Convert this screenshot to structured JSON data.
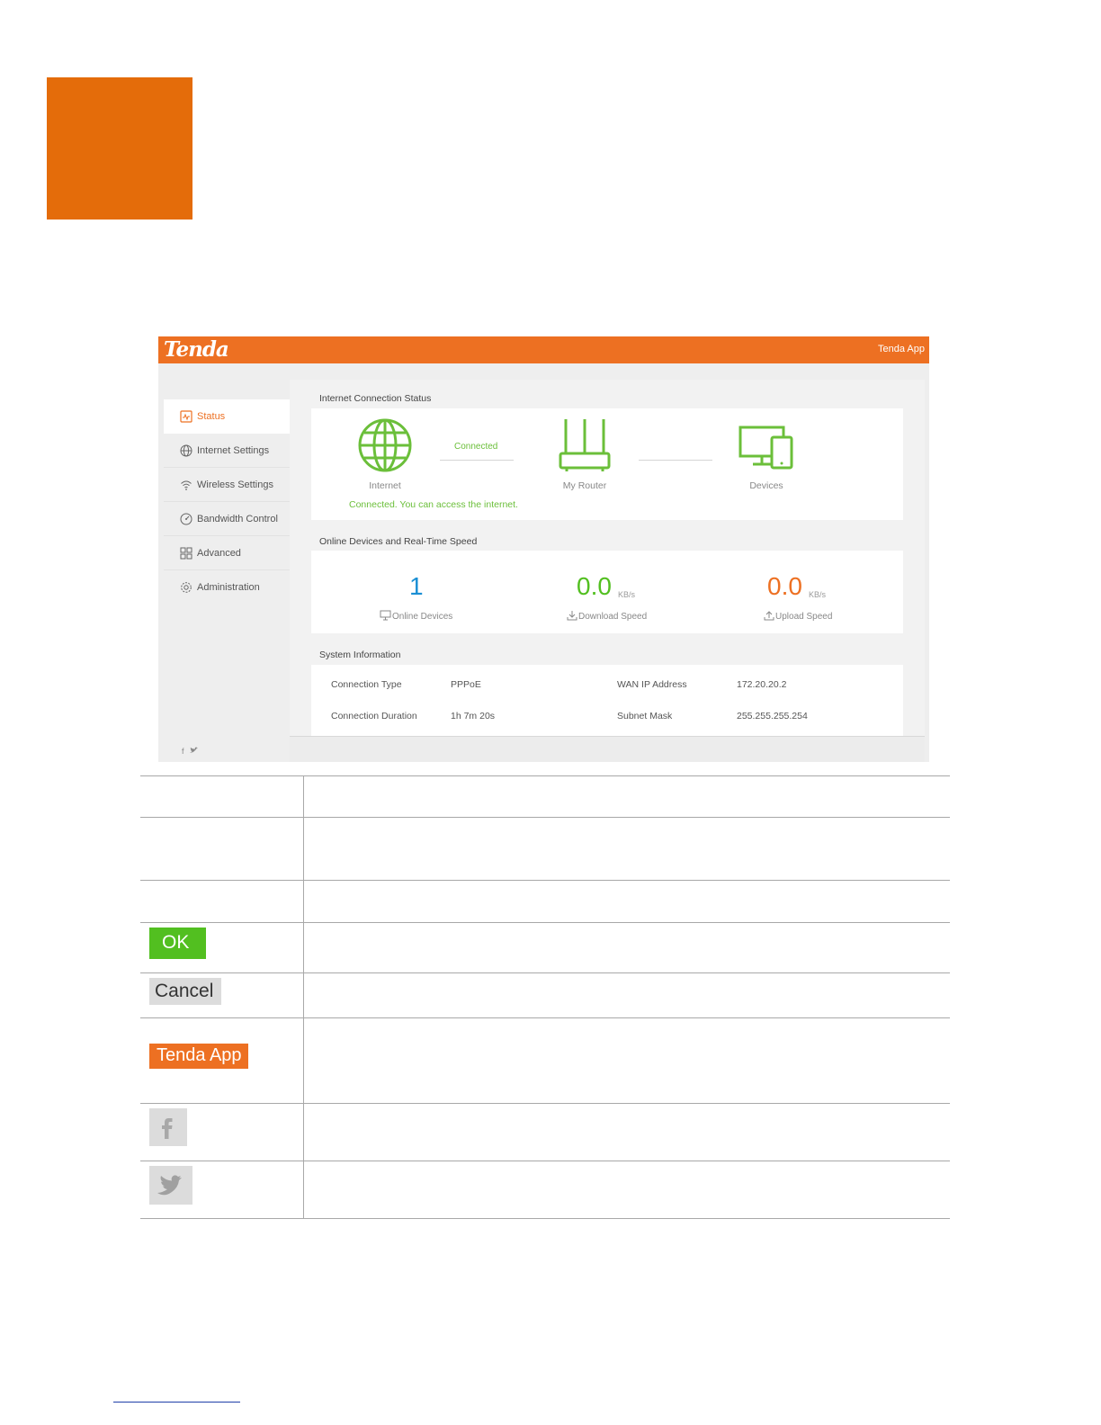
{
  "colors": {
    "brand_orange": "#ed7022",
    "chapter_orange": "#e46c0a",
    "status_green": "#6bbf3a",
    "download_green": "#52bf20",
    "online_blue": "#1a8fd4"
  },
  "header": {
    "logo_text": "Tenda",
    "app_link": "Tenda App"
  },
  "sidebar": {
    "items": [
      {
        "label": "Status",
        "icon": "status-icon"
      },
      {
        "label": "Internet Settings",
        "icon": "globe-icon"
      },
      {
        "label": "Wireless Settings",
        "icon": "wifi-icon"
      },
      {
        "label": "Bandwidth Control",
        "icon": "gauge-icon"
      },
      {
        "label": "Advanced",
        "icon": "grid-icon"
      },
      {
        "label": "Administration",
        "icon": "gear-icon"
      }
    ],
    "social": {
      "facebook": "f",
      "twitter": "🐦"
    }
  },
  "status": {
    "section_title": "Internet Connection Status",
    "internet_label": "Internet",
    "link_status": "Connected",
    "router_label": "My Router",
    "devices_label": "Devices",
    "message": "Connected. You can access the internet."
  },
  "speed": {
    "section_title": "Online Devices and Real-Time Speed",
    "online_count": "1",
    "online_label": "Online Devices",
    "download_value": "0.0",
    "download_unit": "KB/s",
    "download_label": "Download Speed",
    "upload_value": "0.0",
    "upload_unit": "KB/s",
    "upload_label": "Upload Speed"
  },
  "system": {
    "section_title": "System Information",
    "connection_type_label": "Connection Type",
    "connection_type_value": "PPPoE",
    "wan_ip_label": "WAN IP Address",
    "wan_ip_value": "172.20.20.2",
    "duration_label": "Connection Duration",
    "duration_value": "1h 7m 20s",
    "subnet_label": "Subnet Mask",
    "subnet_value": "255.255.255.254"
  },
  "table": {
    "ok_label": "OK",
    "cancel_label": "Cancel",
    "app_label": "Tenda App"
  }
}
